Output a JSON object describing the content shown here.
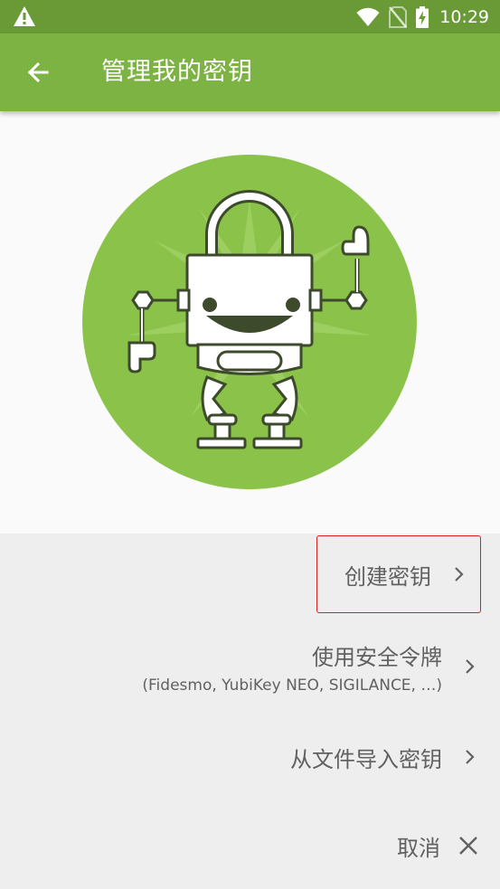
{
  "status_bar": {
    "time": "10:29",
    "icons": [
      "warning-icon",
      "wifi-icon",
      "no-sim-icon",
      "battery-charging-icon"
    ]
  },
  "app_bar": {
    "back_icon": "arrow-left-icon",
    "title": "管理我的密钥"
  },
  "hero": {
    "illustration": "padlock-robot",
    "circle_color": "#8bc34a"
  },
  "actions": {
    "create_key": {
      "label": "创建密钥",
      "icon": "chevron-right-icon"
    },
    "security_token": {
      "label": "使用安全令牌",
      "sub": "(Fidesmo, YubiKey NEO, SIGILANCE, …)",
      "icon": "chevron-right-icon"
    },
    "import_file": {
      "label": "从文件导入密钥",
      "icon": "chevron-right-icon"
    },
    "cancel": {
      "label": "取消",
      "icon": "close-icon"
    }
  },
  "colors": {
    "status_bar": "#6a9a35",
    "app_bar": "#7cb342",
    "highlight_border": "#d62222"
  }
}
